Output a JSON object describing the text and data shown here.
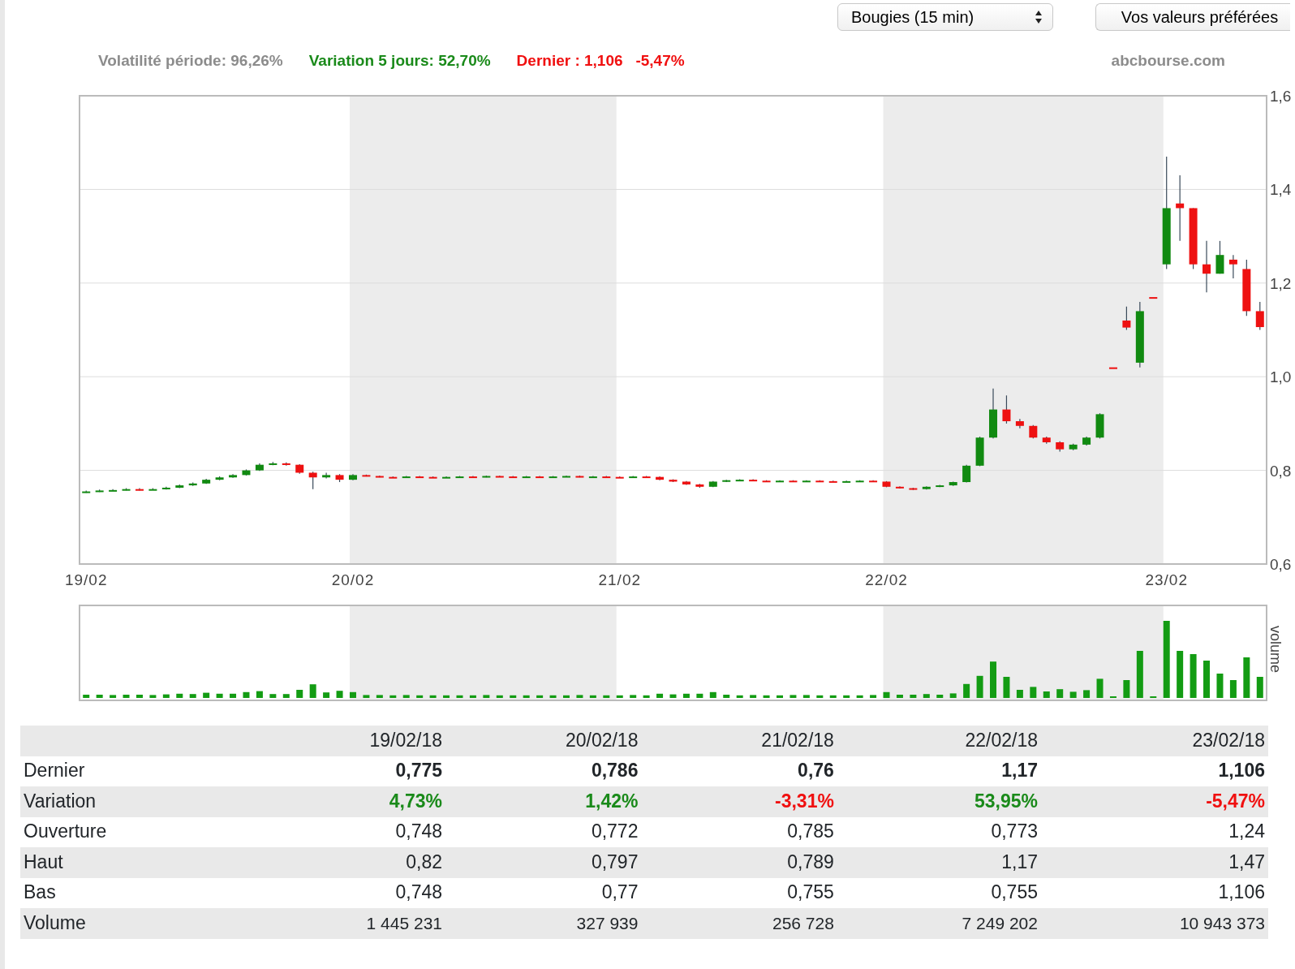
{
  "controls": {
    "chart_type": "Bougies (15 min)",
    "favorites_button": "Vos valeurs préférées"
  },
  "stats": [
    {
      "text": "Volatilité période: 96,26%",
      "color": "#8c8c8c"
    },
    {
      "text": "Variation 5 jours: 52,70%",
      "color": "#1a8a1a"
    },
    {
      "text": "Dernier : 1,106   -5,47%",
      "color": "#f01010"
    }
  ],
  "source": "abcbourse.com",
  "chart": {
    "chart_data": {
      "type": "candlestick",
      "categories": [
        "19/02",
        null,
        null,
        null,
        null,
        null,
        null,
        null,
        null,
        null,
        null,
        null,
        null,
        null,
        null,
        null,
        null,
        null,
        null,
        null,
        "20/02",
        null,
        null,
        null,
        null,
        null,
        null,
        null,
        null,
        null,
        null,
        null,
        null,
        null,
        null,
        null,
        null,
        null,
        null,
        null,
        "21/02",
        null,
        null,
        null,
        null,
        null,
        null,
        null,
        null,
        null,
        null,
        null,
        null,
        null,
        null,
        null,
        null,
        null,
        null,
        null,
        "22/02",
        null,
        null,
        null,
        null,
        null,
        null,
        null,
        null,
        null,
        null,
        null,
        null,
        null,
        null,
        null,
        null,
        null,
        null,
        null,
        null,
        "23/02",
        null,
        null,
        null,
        null,
        null,
        null,
        null
      ],
      "ohlc": [
        [
          0.753,
          0.757,
          0.752,
          0.755
        ],
        [
          0.755,
          0.759,
          0.754,
          0.757
        ],
        [
          0.757,
          0.76,
          0.756,
          0.758
        ],
        [
          0.758,
          0.762,
          0.757,
          0.76
        ],
        [
          0.76,
          0.762,
          0.757,
          0.759
        ],
        [
          0.759,
          0.762,
          0.758,
          0.76
        ],
        [
          0.76,
          0.765,
          0.759,
          0.763
        ],
        [
          0.763,
          0.77,
          0.762,
          0.768
        ],
        [
          0.768,
          0.774,
          0.767,
          0.772
        ],
        [
          0.772,
          0.782,
          0.771,
          0.78
        ],
        [
          0.78,
          0.787,
          0.779,
          0.785
        ],
        [
          0.785,
          0.792,
          0.784,
          0.79
        ],
        [
          0.79,
          0.802,
          0.789,
          0.8
        ],
        [
          0.8,
          0.815,
          0.799,
          0.812
        ],
        [
          0.812,
          0.818,
          0.811,
          0.815
        ],
        [
          0.815,
          0.817,
          0.81,
          0.812
        ],
        [
          0.812,
          0.813,
          0.793,
          0.795
        ],
        [
          0.795,
          0.797,
          0.76,
          0.785
        ],
        [
          0.785,
          0.795,
          0.783,
          0.79
        ],
        [
          0.79,
          0.792,
          0.775,
          0.78
        ],
        [
          0.78,
          0.792,
          0.779,
          0.79
        ],
        [
          0.79,
          0.791,
          0.787,
          0.788
        ],
        [
          0.788,
          0.789,
          0.785,
          0.786
        ],
        [
          0.786,
          0.787,
          0.784,
          0.785
        ],
        [
          0.785,
          0.788,
          0.784,
          0.787
        ],
        [
          0.787,
          0.788,
          0.785,
          0.786
        ],
        [
          0.786,
          0.787,
          0.784,
          0.785
        ],
        [
          0.785,
          0.787,
          0.784,
          0.786
        ],
        [
          0.786,
          0.788,
          0.785,
          0.787
        ],
        [
          0.787,
          0.788,
          0.785,
          0.786
        ],
        [
          0.786,
          0.789,
          0.785,
          0.788
        ],
        [
          0.788,
          0.789,
          0.786,
          0.787
        ],
        [
          0.787,
          0.788,
          0.785,
          0.786
        ],
        [
          0.786,
          0.788,
          0.785,
          0.787
        ],
        [
          0.787,
          0.788,
          0.785,
          0.786
        ],
        [
          0.786,
          0.788,
          0.785,
          0.787
        ],
        [
          0.787,
          0.789,
          0.786,
          0.788
        ],
        [
          0.788,
          0.789,
          0.785,
          0.786
        ],
        [
          0.786,
          0.788,
          0.785,
          0.787
        ],
        [
          0.787,
          0.788,
          0.785,
          0.786
        ],
        [
          0.786,
          0.787,
          0.784,
          0.785
        ],
        [
          0.785,
          0.788,
          0.784,
          0.787
        ],
        [
          0.787,
          0.788,
          0.785,
          0.786
        ],
        [
          0.786,
          0.787,
          0.779,
          0.78
        ],
        [
          0.78,
          0.781,
          0.775,
          0.776
        ],
        [
          0.776,
          0.777,
          0.769,
          0.77
        ],
        [
          0.77,
          0.771,
          0.763,
          0.765
        ],
        [
          0.765,
          0.777,
          0.764,
          0.776
        ],
        [
          0.776,
          0.78,
          0.775,
          0.779
        ],
        [
          0.779,
          0.781,
          0.778,
          0.78
        ],
        [
          0.78,
          0.781,
          0.777,
          0.778
        ],
        [
          0.778,
          0.779,
          0.776,
          0.777
        ],
        [
          0.777,
          0.779,
          0.776,
          0.778
        ],
        [
          0.778,
          0.779,
          0.775,
          0.776
        ],
        [
          0.776,
          0.779,
          0.775,
          0.778
        ],
        [
          0.778,
          0.779,
          0.776,
          0.777
        ],
        [
          0.777,
          0.778,
          0.775,
          0.776
        ],
        [
          0.776,
          0.778,
          0.775,
          0.777
        ],
        [
          0.777,
          0.779,
          0.776,
          0.778
        ],
        [
          0.778,
          0.779,
          0.775,
          0.776
        ],
        [
          0.776,
          0.777,
          0.764,
          0.765
        ],
        [
          0.765,
          0.766,
          0.761,
          0.762
        ],
        [
          0.762,
          0.763,
          0.758,
          0.76
        ],
        [
          0.76,
          0.766,
          0.759,
          0.765
        ],
        [
          0.765,
          0.769,
          0.764,
          0.768
        ],
        [
          0.768,
          0.776,
          0.767,
          0.775
        ],
        [
          0.775,
          0.812,
          0.774,
          0.81
        ],
        [
          0.81,
          0.872,
          0.809,
          0.87
        ],
        [
          0.87,
          0.975,
          0.868,
          0.93
        ],
        [
          0.93,
          0.96,
          0.9,
          0.905
        ],
        [
          0.905,
          0.91,
          0.89,
          0.895
        ],
        [
          0.895,
          0.897,
          0.868,
          0.87
        ],
        [
          0.87,
          0.872,
          0.857,
          0.86
        ],
        [
          0.86,
          0.862,
          0.84,
          0.845
        ],
        [
          0.845,
          0.857,
          0.843,
          0.855
        ],
        [
          0.855,
          0.872,
          0.853,
          0.87
        ],
        [
          0.87,
          0.922,
          0.868,
          0.92
        ],
        [
          1.02,
          1.02,
          1.02,
          1.02
        ],
        [
          1.12,
          1.15,
          1.1,
          1.105
        ],
        [
          1.03,
          1.16,
          1.02,
          1.14
        ],
        [
          1.17,
          1.17,
          1.17,
          1.17
        ],
        [
          1.24,
          1.47,
          1.23,
          1.36
        ],
        [
          1.37,
          1.43,
          1.29,
          1.36
        ],
        [
          1.36,
          1.36,
          1.23,
          1.24
        ],
        [
          1.24,
          1.29,
          1.18,
          1.22
        ],
        [
          1.22,
          1.29,
          1.22,
          1.26
        ],
        [
          1.25,
          1.26,
          1.21,
          1.24
        ],
        [
          1.23,
          1.25,
          1.13,
          1.14
        ],
        [
          1.14,
          1.16,
          1.1,
          1.106
        ]
      ],
      "ylim": [
        0.6,
        1.6
      ],
      "grid": true,
      "yticks": [
        {
          "value": 1.6,
          "label": "1,6"
        },
        {
          "value": 1.4,
          "label": "1,4"
        },
        {
          "value": 1.2,
          "label": "1,2"
        },
        {
          "value": 1.0,
          "label": "1,0"
        },
        {
          "value": 0.8,
          "label": "0,8"
        },
        {
          "value": 0.6,
          "label": "0,6"
        }
      ]
    },
    "volume_label": "volume"
  },
  "table": {
    "columns": [
      "19/02/18",
      "20/02/18",
      "21/02/18",
      "22/02/18",
      "23/02/18"
    ],
    "rows": [
      {
        "label": "Dernier",
        "kind": "bold",
        "cells": [
          {
            "text": "0,775"
          },
          {
            "text": "0,786"
          },
          {
            "text": "0,76"
          },
          {
            "text": "1,17"
          },
          {
            "text": "1,106"
          }
        ]
      },
      {
        "label": "Variation",
        "kind": "variation",
        "cells": [
          {
            "text": "4,73%",
            "color": "#1a8a1a"
          },
          {
            "text": "1,42%",
            "color": "#1a8a1a"
          },
          {
            "text": "-3,31%",
            "color": "#f01010"
          },
          {
            "text": "53,95%",
            "color": "#1a8a1a"
          },
          {
            "text": "-5,47%",
            "color": "#f01010"
          }
        ]
      },
      {
        "label": "Ouverture",
        "kind": "plain",
        "cells": [
          {
            "text": "0,748"
          },
          {
            "text": "0,772"
          },
          {
            "text": "0,785"
          },
          {
            "text": "0,773"
          },
          {
            "text": "1,24"
          }
        ]
      },
      {
        "label": "Haut",
        "kind": "plain",
        "cells": [
          {
            "text": "0,82"
          },
          {
            "text": "0,797"
          },
          {
            "text": "0,789"
          },
          {
            "text": "1,17"
          },
          {
            "text": "1,47"
          }
        ]
      },
      {
        "label": "Bas",
        "kind": "plain",
        "cells": [
          {
            "text": "0,748"
          },
          {
            "text": "0,77"
          },
          {
            "text": "0,755"
          },
          {
            "text": "0,755"
          },
          {
            "text": "1,106"
          }
        ]
      },
      {
        "label": "Volume",
        "kind": "small",
        "cells": [
          {
            "text": "1 445 231"
          },
          {
            "text": "327 939"
          },
          {
            "text": "256 728"
          },
          {
            "text": "7 249 202"
          },
          {
            "text": "10 943 373"
          }
        ]
      }
    ]
  }
}
